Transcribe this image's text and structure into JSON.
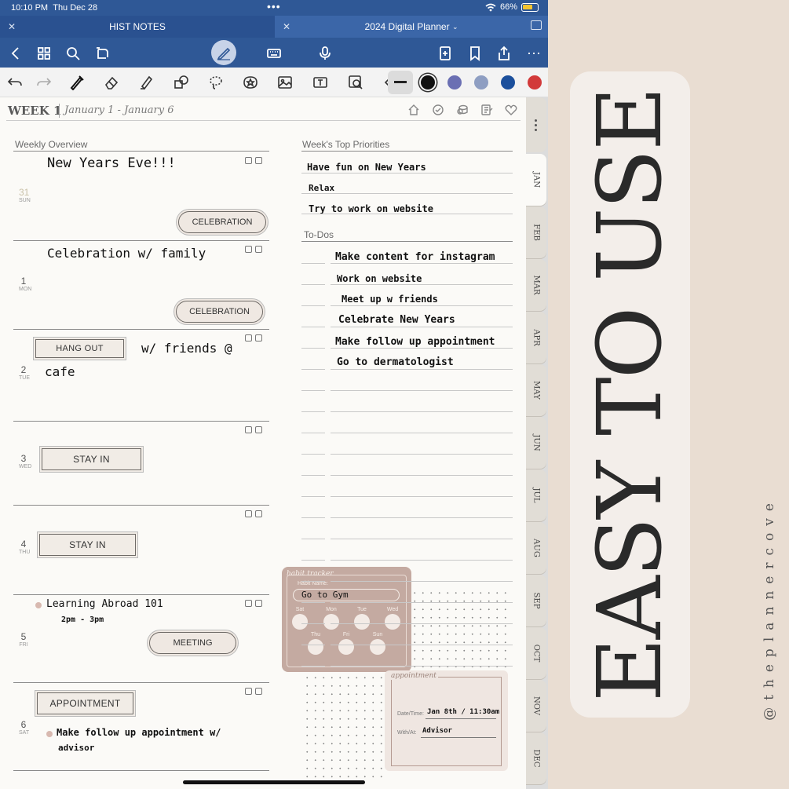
{
  "status": {
    "time": "10:10 PM",
    "date": "Thu Dec 28",
    "battery": "66%"
  },
  "tabs": [
    {
      "label": "HIST NOTES"
    },
    {
      "label": "2024 Digital Planner"
    }
  ],
  "tools": {
    "colors": [
      "#111111",
      "#6a6fb3",
      "#8e9ec2",
      "#1b4f9c",
      "#d23a3a"
    ]
  },
  "header": {
    "week": "WEEK 1",
    "range": "January 1 - January 6"
  },
  "weekly_overview": {
    "label": "Weekly Overview",
    "days": [
      {
        "num": "31",
        "dow": "SUN",
        "note": "New Years Eve!!!",
        "sticker": "CELEBRATION"
      },
      {
        "num": "1",
        "dow": "MON",
        "note": "Celebration w/ family",
        "sticker": "CELEBRATION"
      },
      {
        "num": "2",
        "dow": "TUE",
        "sticker": "HANG OUT",
        "note": "w/ friends @",
        "note2": "cafe"
      },
      {
        "num": "3",
        "dow": "WED",
        "sticker": "STAY IN"
      },
      {
        "num": "4",
        "dow": "THU",
        "sticker": "STAY IN"
      },
      {
        "num": "5",
        "dow": "FRI",
        "note": "Learning Abroad 101",
        "note2": "2pm - 3pm",
        "sticker": "MEETING"
      },
      {
        "num": "6",
        "dow": "SAT",
        "sticker": "APPOINTMENT",
        "note": "Make follow up appointment w/",
        "note2": "advisor"
      }
    ]
  },
  "priorities": {
    "label": "Week's Top Priorities",
    "items": [
      "Have fun on New Years",
      "Relax",
      "Try to work on website"
    ]
  },
  "todos": {
    "label": "To-Dos",
    "items": [
      "Make content for instagram",
      "Work on website",
      "Meet up w friends",
      "Celebrate New Years",
      "Make follow up appointment",
      "Go to dermatologist"
    ]
  },
  "habit_tracker": {
    "title": "habit tracker",
    "name_label": "Habit Name:",
    "name_value": "Go to Gym",
    "days": [
      "Sat",
      "Mon",
      "Tue",
      "Wed",
      "Thu",
      "Fri",
      "Sun"
    ]
  },
  "appointment": {
    "title": "appointment",
    "datetime_label": "Date/Time:",
    "datetime_value": "Jan 8th / 11:30am",
    "with_label": "With/At:",
    "with_value": "Advisor"
  },
  "months": [
    "JAN",
    "FEB",
    "MAR",
    "APR",
    "MAY",
    "JUN",
    "JUL",
    "AUG",
    "SEP",
    "OCT",
    "NOV",
    "DEC"
  ],
  "promo": {
    "headline": "EASY TO USE",
    "handle": "@theplannercove"
  }
}
